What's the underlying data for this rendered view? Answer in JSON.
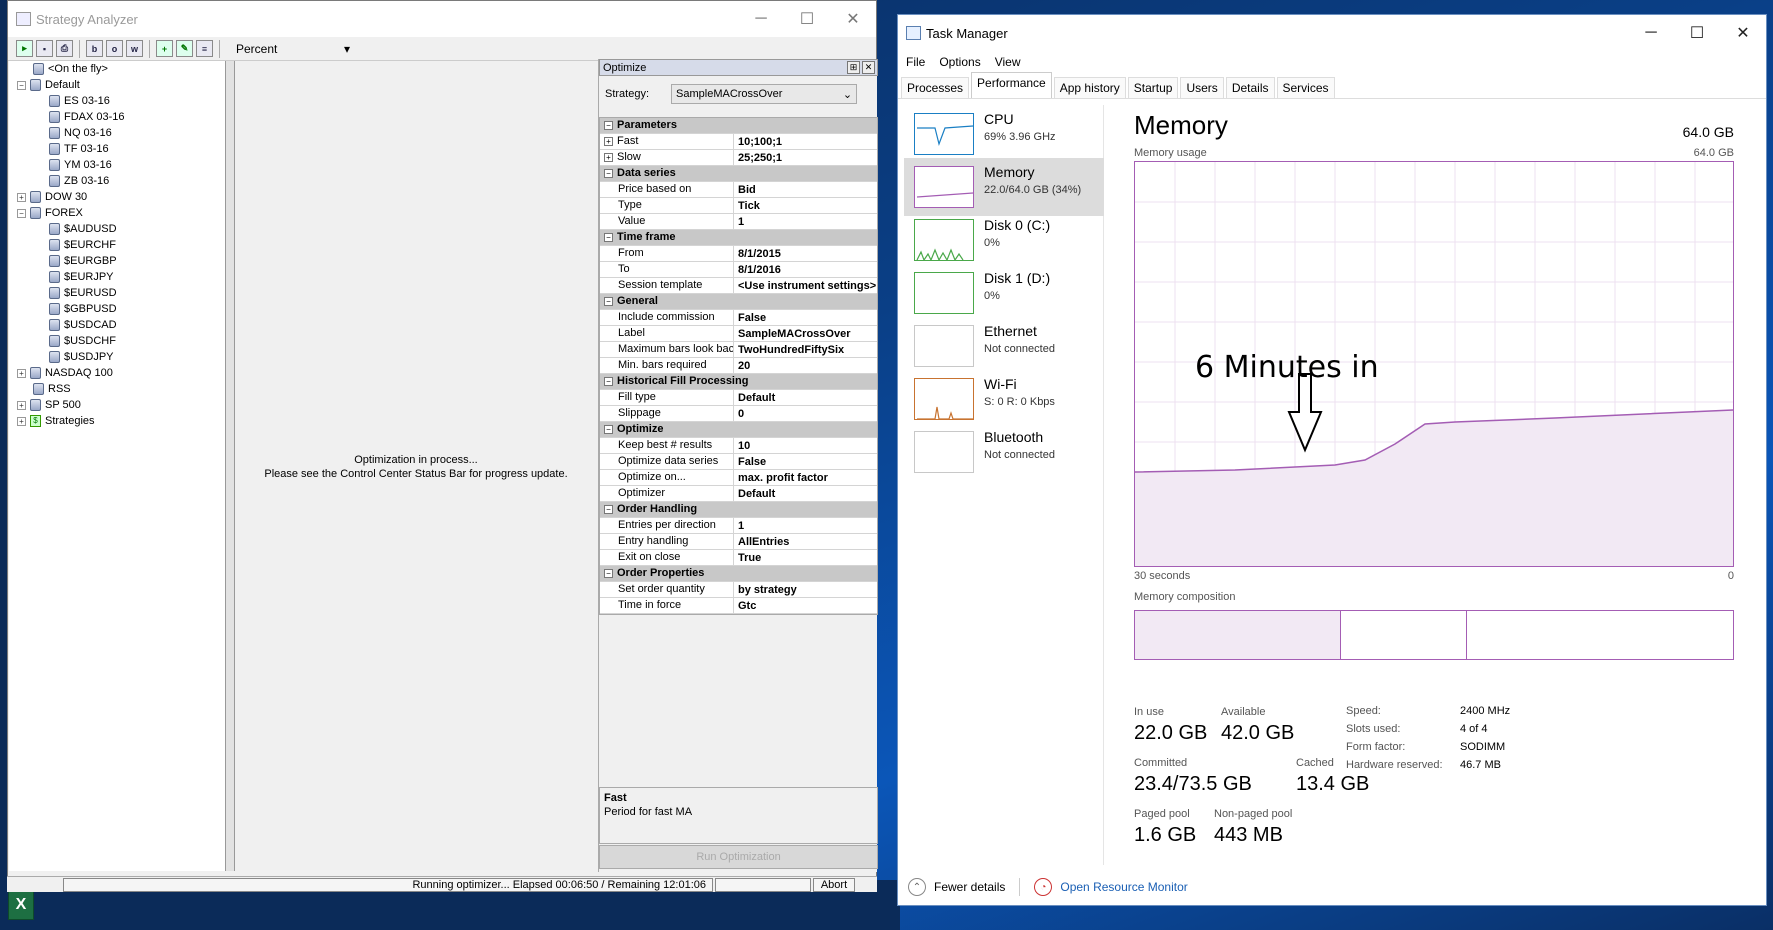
{
  "strategy_analyzer": {
    "title": "Strategy Analyzer",
    "toolbar": {
      "combo_value": "Percent"
    },
    "tree": [
      {
        "label": "<On the fly>",
        "depth": 1,
        "expander": "",
        "icon": "db"
      },
      {
        "label": "Default",
        "depth": 0,
        "expander": "−",
        "icon": "db"
      },
      {
        "label": "ES 03-16",
        "depth": 2,
        "expander": "",
        "icon": "db"
      },
      {
        "label": "FDAX 03-16",
        "depth": 2,
        "expander": "",
        "icon": "db"
      },
      {
        "label": "NQ 03-16",
        "depth": 2,
        "expander": "",
        "icon": "db"
      },
      {
        "label": "TF 03-16",
        "depth": 2,
        "expander": "",
        "icon": "db"
      },
      {
        "label": "YM 03-16",
        "depth": 2,
        "expander": "",
        "icon": "db"
      },
      {
        "label": "ZB 03-16",
        "depth": 2,
        "expander": "",
        "icon": "db"
      },
      {
        "label": "DOW 30",
        "depth": 0,
        "expander": "+",
        "icon": "db"
      },
      {
        "label": "FOREX",
        "depth": 0,
        "expander": "−",
        "icon": "db"
      },
      {
        "label": "$AUDUSD",
        "depth": 2,
        "expander": "",
        "icon": "db"
      },
      {
        "label": "$EURCHF",
        "depth": 2,
        "expander": "",
        "icon": "db"
      },
      {
        "label": "$EURGBP",
        "depth": 2,
        "expander": "",
        "icon": "db"
      },
      {
        "label": "$EURJPY",
        "depth": 2,
        "expander": "",
        "icon": "db"
      },
      {
        "label": "$EURUSD",
        "depth": 2,
        "expander": "",
        "icon": "db"
      },
      {
        "label": "$GBPUSD",
        "depth": 2,
        "expander": "",
        "icon": "db"
      },
      {
        "label": "$USDCAD",
        "depth": 2,
        "expander": "",
        "icon": "db"
      },
      {
        "label": "$USDCHF",
        "depth": 2,
        "expander": "",
        "icon": "db"
      },
      {
        "label": "$USDJPY",
        "depth": 2,
        "expander": "",
        "icon": "db"
      },
      {
        "label": "NASDAQ 100",
        "depth": 0,
        "expander": "+",
        "icon": "db"
      },
      {
        "label": "RSS",
        "depth": 1,
        "expander": "",
        "icon": "db"
      },
      {
        "label": "SP 500",
        "depth": 0,
        "expander": "+",
        "icon": "db"
      },
      {
        "label": "Strategies",
        "depth": 0,
        "expander": "+",
        "icon": "strategy"
      }
    ],
    "center": {
      "line1": "Optimization in process...",
      "line2": "Please see the Control Center Status Bar for progress update."
    },
    "optimize": {
      "header": "Optimize",
      "strategy_label": "Strategy:",
      "strategy_value": "SampleMACrossOver",
      "grid": [
        {
          "type": "section",
          "label": "Parameters"
        },
        {
          "type": "plus",
          "label": "Fast",
          "value": "10;100;1"
        },
        {
          "type": "plus",
          "label": "Slow",
          "value": "25;250;1"
        },
        {
          "type": "section",
          "label": "Data series"
        },
        {
          "type": "row",
          "label": "Price based on",
          "value": "Bid"
        },
        {
          "type": "row",
          "label": "Type",
          "value": "Tick"
        },
        {
          "type": "row",
          "label": "Value",
          "value": "1"
        },
        {
          "type": "section",
          "label": "Time frame"
        },
        {
          "type": "row",
          "label": "From",
          "value": "8/1/2015"
        },
        {
          "type": "row",
          "label": "To",
          "value": "8/1/2016"
        },
        {
          "type": "row",
          "label": "Session template",
          "value": "<Use instrument settings>"
        },
        {
          "type": "section",
          "label": "General"
        },
        {
          "type": "row",
          "label": "Include commission",
          "value": "False"
        },
        {
          "type": "row",
          "label": "Label",
          "value": "SampleMACrossOver"
        },
        {
          "type": "row",
          "label": "Maximum bars look bac",
          "value": "TwoHundredFiftySix"
        },
        {
          "type": "row",
          "label": "Min. bars required",
          "value": "20"
        },
        {
          "type": "section",
          "label": "Historical Fill Processing"
        },
        {
          "type": "row",
          "label": "Fill type",
          "value": "Default"
        },
        {
          "type": "row",
          "label": "Slippage",
          "value": "0"
        },
        {
          "type": "section",
          "label": "Optimize"
        },
        {
          "type": "row",
          "label": "Keep best # results",
          "value": "10"
        },
        {
          "type": "row",
          "label": "Optimize data series",
          "value": "False"
        },
        {
          "type": "row",
          "label": "Optimize on...",
          "value": "max. profit factor"
        },
        {
          "type": "row",
          "label": "Optimizer",
          "value": "Default"
        },
        {
          "type": "section",
          "label": "Order Handling"
        },
        {
          "type": "row",
          "label": "Entries per direction",
          "value": "1"
        },
        {
          "type": "row",
          "label": "Entry handling",
          "value": "AllEntries"
        },
        {
          "type": "row",
          "label": "Exit on close",
          "value": "True"
        },
        {
          "type": "section",
          "label": "Order Properties"
        },
        {
          "type": "row",
          "label": "Set order quantity",
          "value": "by strategy"
        },
        {
          "type": "row",
          "label": "Time in force",
          "value": "Gtc"
        }
      ],
      "desc_title": "Fast",
      "desc_text": "Period for fast MA",
      "run_label": "Run Optimization"
    },
    "status": {
      "text": "Running optimizer... Elapsed 00:06:50 / Remaining 12:01:06",
      "abort": "Abort"
    }
  },
  "task_manager": {
    "title": "Task Manager",
    "menu": [
      "File",
      "Options",
      "View"
    ],
    "tabs": [
      "Processes",
      "Performance",
      "App history",
      "Startup",
      "Users",
      "Details",
      "Services"
    ],
    "active_tab": "Performance",
    "resources": [
      {
        "name": "CPU",
        "sub": "69% 3.96 GHz",
        "color": "#1a7fc4"
      },
      {
        "name": "Memory",
        "sub": "22.0/64.0 GB (34%)",
        "color": "#a45db4"
      },
      {
        "name": "Disk 0 (C:)",
        "sub": "0%",
        "color": "#4aa84a"
      },
      {
        "name": "Disk 1 (D:)",
        "sub": "0%",
        "color": "#4aa84a"
      },
      {
        "name": "Ethernet",
        "sub": "Not connected",
        "color": "#c8c8c8"
      },
      {
        "name": "Wi-Fi",
        "sub": "S: 0 R: 0 Kbps",
        "color": "#c87330"
      },
      {
        "name": "Bluetooth",
        "sub": "Not connected",
        "color": "#c8c8c8"
      }
    ],
    "panel": {
      "title": "Memory",
      "total": "64.0 GB",
      "usage_label": "Memory usage",
      "usage_max": "64.0 GB",
      "axis_left": "30 seconds",
      "axis_right": "0",
      "composition_label": "Memory composition",
      "annotation": "6 Minutes in",
      "stats": {
        "in_use_label": "In use",
        "in_use": "22.0 GB",
        "available_label": "Available",
        "available": "42.0 GB",
        "committed_label": "Committed",
        "committed": "23.4/73.5 GB",
        "cached_label": "Cached",
        "cached": "13.4 GB",
        "paged_label": "Paged pool",
        "paged": "1.6 GB",
        "nonpaged_label": "Non-paged pool",
        "nonpaged": "443 MB"
      },
      "details": [
        {
          "k": "Speed:",
          "v": "2400 MHz"
        },
        {
          "k": "Slots used:",
          "v": "4 of 4"
        },
        {
          "k": "Form factor:",
          "v": "SODIMM"
        },
        {
          "k": "Hardware reserved:",
          "v": "46.7 MB"
        }
      ]
    },
    "footer": {
      "fewer": "Fewer details",
      "monitor": "Open Resource Monitor"
    }
  }
}
